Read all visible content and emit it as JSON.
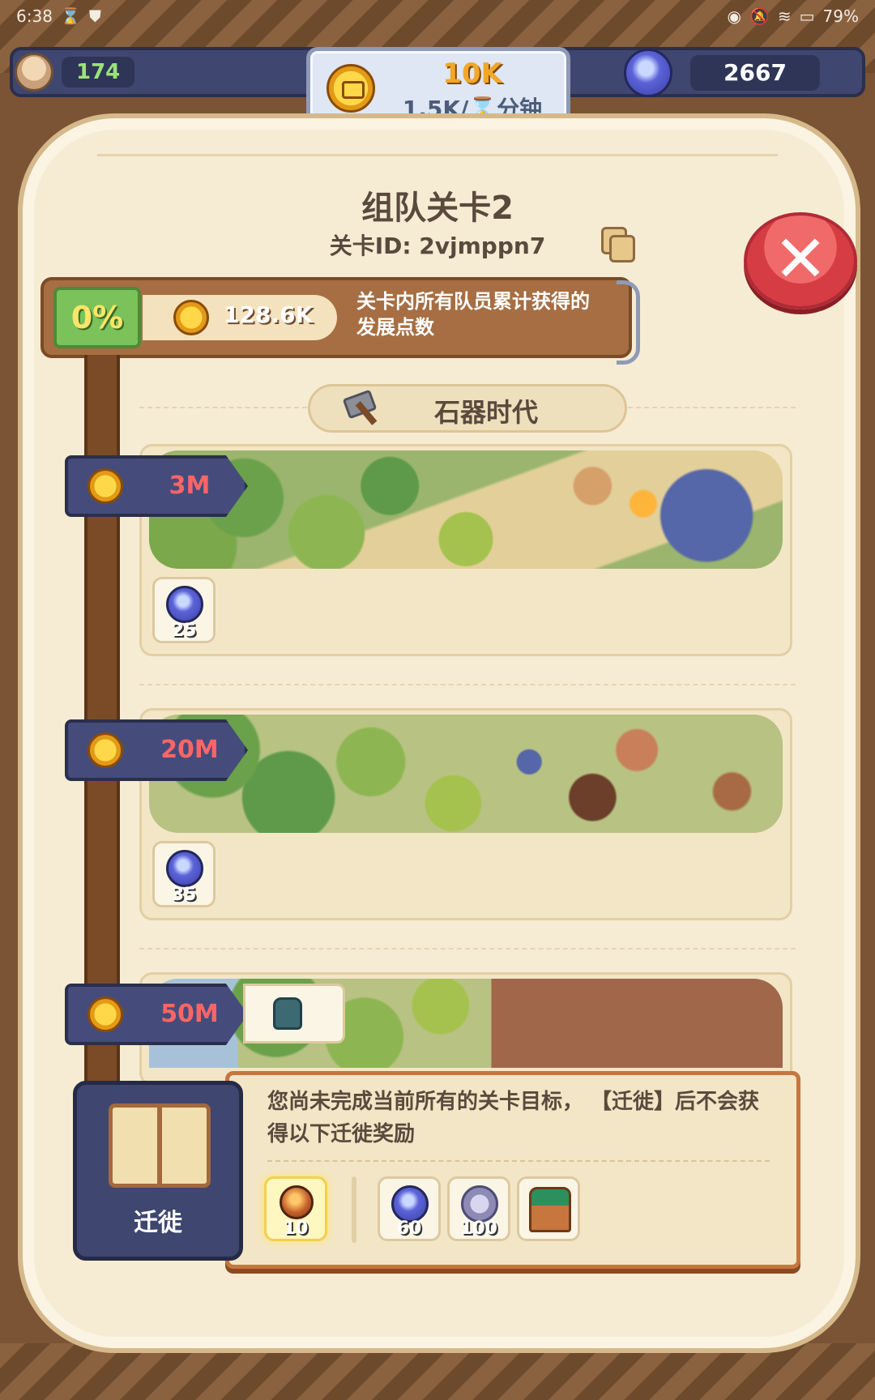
{
  "status_bar": {
    "time": "6:38",
    "battery": "79%"
  },
  "resources": {
    "population": "174",
    "gold_total": "10K",
    "gold_rate": "1.5K/⌛分钟",
    "gems": "2667"
  },
  "level": {
    "title": "组队关卡2",
    "id_label": "关卡ID: 2vjmppn7"
  },
  "progress": {
    "percent": "0%",
    "points": "128.6K",
    "description": "关卡内所有队员累计获得的发展点数"
  },
  "era": {
    "label": "石器时代"
  },
  "stages": [
    {
      "threshold": "3M",
      "reward_count": "25",
      "image": "forest-camp"
    },
    {
      "threshold": "20M",
      "reward_count": "35",
      "image": "forest-hunt"
    },
    {
      "threshold": "50M",
      "image": "farm"
    }
  ],
  "migrate": {
    "message": "您尚未完成当前所有的关卡目标， 【迁徙】后不会获得以下迁徙奖励",
    "button_label": "迁徙",
    "items": [
      {
        "icon": "orb-icon",
        "count": "10"
      },
      {
        "icon": "gem-icon",
        "count": "60"
      },
      {
        "icon": "silver-coin-icon",
        "count": "100"
      },
      {
        "icon": "chest-icon",
        "count": ""
      }
    ]
  },
  "colors": {
    "accent_red": "#d63c44",
    "panel_bg": "#f6ecd4",
    "nav_blue": "#3f4670",
    "progress_green": "#7bc25a"
  }
}
